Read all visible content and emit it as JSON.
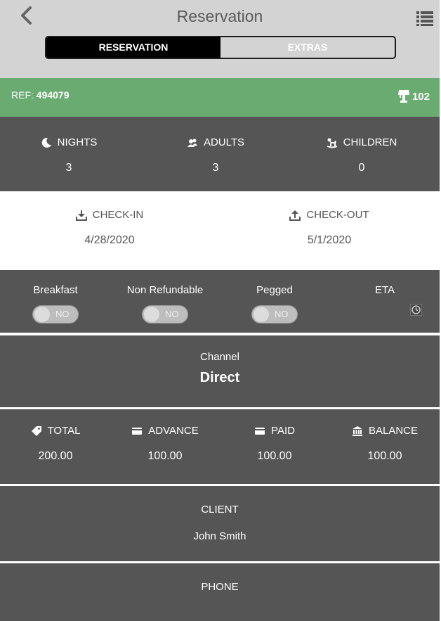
{
  "header": {
    "title": "Reservation",
    "back_icon": "chevron-left-icon",
    "menu_icon": "list-icon",
    "tabs": [
      {
        "label": "RESERVATION",
        "active": true
      },
      {
        "label": "EXTRAS",
        "active": false
      }
    ]
  },
  "ref": {
    "prefix": "REF:",
    "number": "494079",
    "room_icon": "lamp-icon",
    "room": "102"
  },
  "stats": [
    {
      "icon": "moon-icon",
      "label": "NIGHTS",
      "value": "3"
    },
    {
      "icon": "adults-icon",
      "label": "ADULTS",
      "value": "3"
    },
    {
      "icon": "rocking-horse-icon",
      "label": "CHILDREN",
      "value": "0"
    }
  ],
  "dates": [
    {
      "icon": "download-icon",
      "label": "CHECK-IN",
      "value": "4/28/2020"
    },
    {
      "icon": "upload-icon",
      "label": "CHECK-OUT",
      "value": "5/1/2020"
    }
  ],
  "options": [
    {
      "label": "Breakfast",
      "state": "NO"
    },
    {
      "label": "Non Refundable",
      "state": "NO"
    },
    {
      "label": "Pegged",
      "state": "NO"
    }
  ],
  "eta": {
    "label": "ETA",
    "icon": "clock-icon"
  },
  "channel": {
    "label": "Channel",
    "value": "Direct"
  },
  "amounts": [
    {
      "icon": "tag-icon",
      "label": "TOTAL",
      "value": "200.00"
    },
    {
      "icon": "credit-card-icon",
      "label": "ADVANCE",
      "value": "100.00"
    },
    {
      "icon": "credit-card-icon",
      "label": "PAID",
      "value": "100.00"
    },
    {
      "icon": "bank-icon",
      "label": "BALANCE",
      "value": "100.00"
    }
  ],
  "client": {
    "label": "CLIENT",
    "value": "John Smith"
  },
  "phone": {
    "label": "PHONE"
  },
  "colors": {
    "header_bg": "#d3d3d3",
    "ref_bg": "#6aab72",
    "panel_bg": "#555555"
  }
}
